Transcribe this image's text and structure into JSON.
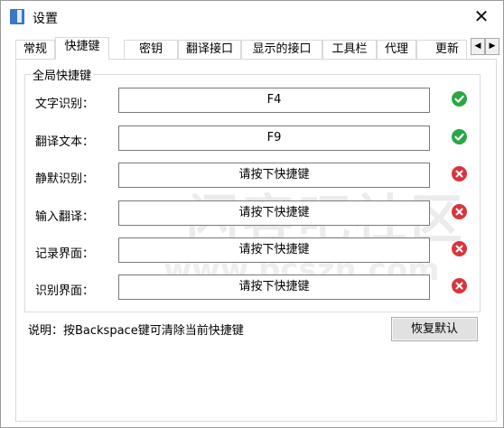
{
  "window": {
    "title": "设置",
    "close_glyph": "✕"
  },
  "tabs": [
    {
      "label": "常规",
      "active": false
    },
    {
      "label": "快捷键",
      "active": true
    },
    {
      "label": "密钥",
      "active": false
    },
    {
      "label": "翻译接口",
      "active": false
    },
    {
      "label": "显示的接口",
      "active": false
    },
    {
      "label": "工具栏",
      "active": false
    },
    {
      "label": "代理",
      "active": false
    },
    {
      "label": "更新",
      "active": false
    }
  ],
  "tab_scroll": {
    "left_glyph": "◀",
    "right_glyph": "▶"
  },
  "group": {
    "title": "全局快捷键"
  },
  "hotkeys": [
    {
      "label": "文字识别：",
      "value": "F4",
      "status": "set"
    },
    {
      "label": "翻译文本：",
      "value": "F9",
      "status": "set"
    },
    {
      "label": "静默识别：",
      "value": "请按下快捷键",
      "status": "unset"
    },
    {
      "label": "输入翻译：",
      "value": "请按下快捷键",
      "status": "unset"
    },
    {
      "label": "记录界面：",
      "value": "请按下快捷键",
      "status": "unset"
    },
    {
      "label": "识别界面：",
      "value": "请按下快捷键",
      "status": "unset"
    }
  ],
  "note": "说明：按Backspace键可清除当前快捷键",
  "restore_button": "恢复默认",
  "watermark": {
    "line1": "闪客吧社区",
    "line2": "www.pcszh.com"
  },
  "colors": {
    "ok": "#27a844",
    "error": "#d9343d"
  },
  "icons": {
    "ok": "check-circle-icon",
    "error": "x-circle-icon"
  }
}
